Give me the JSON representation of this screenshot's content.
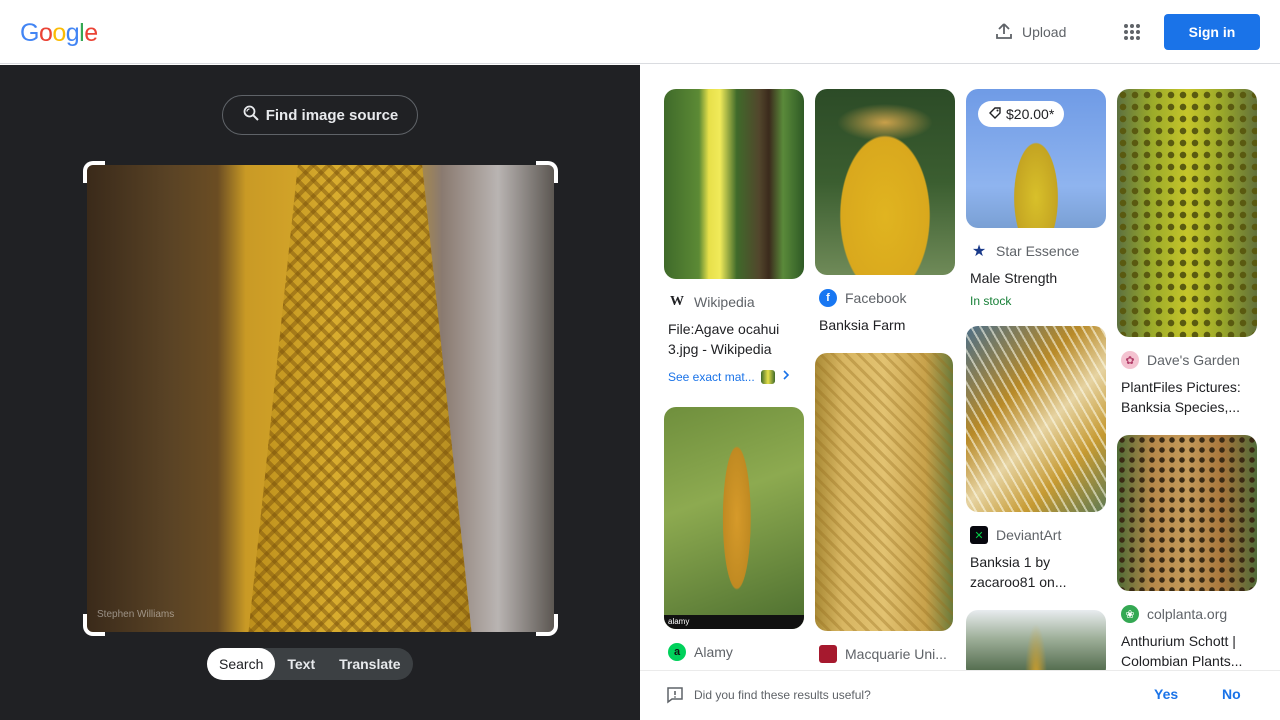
{
  "header": {
    "logo_letters": [
      "G",
      "o",
      "o",
      "g",
      "l",
      "e"
    ],
    "logo_colors": [
      "#4285f4",
      "#ea4335",
      "#fbbc05",
      "#4285f4",
      "#34a853",
      "#ea4335"
    ],
    "upload_label": "Upload",
    "signin_label": "Sign in",
    "signin_color": "#1a73e8"
  },
  "left_panel": {
    "find_source_label": "Find image source",
    "watermark": "Stephen Williams",
    "tabs": [
      "Search",
      "Text",
      "Translate"
    ],
    "active_tab": "Search"
  },
  "results": [
    {
      "source": "Wikipedia",
      "title": "File:Agave ocahui 3.jpg - Wikipedia",
      "exact_label": "See exact mat...",
      "icon": "wikipedia-icon"
    },
    {
      "source": "Facebook",
      "title": "Banksia Farm",
      "icon": "facebook-icon"
    },
    {
      "source": "Star Essence",
      "title": "Male Strength",
      "price": "$20.00*",
      "meta": "In stock",
      "icon": "star-icon"
    },
    {
      "source": "Dave's Garden",
      "title": "PlantFiles Pictures: Banksia Species,...",
      "icon": "flower-icon"
    },
    {
      "source": "Alamy",
      "title": "",
      "icon": "alamy-icon",
      "watermark": "alamy"
    },
    {
      "source": "Macquarie Uni...",
      "title": "",
      "icon": "shield-icon"
    },
    {
      "source": "DeviantArt",
      "title": "Banksia 1 by zacaroo81 on...",
      "icon": "deviantart-icon"
    },
    {
      "source": "colplanta.org",
      "title": "Anthurium Schott | Colombian Plants...",
      "icon": "leaf-icon"
    }
  ],
  "feedback": {
    "question": "Did you find these results useful?",
    "yes": "Yes",
    "no": "No"
  }
}
